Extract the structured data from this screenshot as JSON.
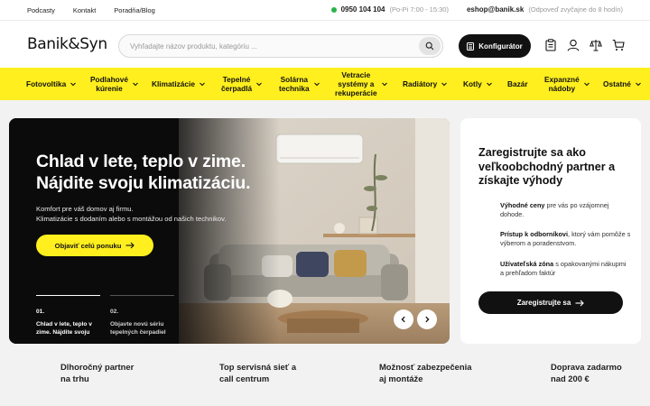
{
  "topbar": {
    "links": [
      "Podcasty",
      "Kontakt",
      "Poradňa/Blog"
    ],
    "phone": "0950 104 104",
    "hours": "(Po-Pi 7:00 - 15:30)",
    "email": "eshop@banik.sk",
    "reply_note": "(Odpoveď zvyčajne do 8 hodín)"
  },
  "header": {
    "logo": "Banik&Syn",
    "search_placeholder": "Vyhľadajte názov produktu, kategóriu ...",
    "configurator_label": "Konfigurátor",
    "icons": [
      "clipboard-icon",
      "user-icon",
      "compare-scales-icon",
      "cart-icon"
    ]
  },
  "nav": {
    "items": [
      {
        "line1": "Fotovoltika",
        "line2": "",
        "line3": "",
        "chevron": true
      },
      {
        "line1": "Podlahové",
        "line2": "kúrenie",
        "line3": "",
        "chevron": true
      },
      {
        "line1": "Klimatizácie",
        "line2": "",
        "line3": "",
        "chevron": true
      },
      {
        "line1": "Tepelné",
        "line2": "čerpadlá",
        "line3": "",
        "chevron": true
      },
      {
        "line1": "Solárna",
        "line2": "technika",
        "line3": "",
        "chevron": true
      },
      {
        "line1": "Vetracie",
        "line2": "systémy a",
        "line3": "rekuperácie",
        "chevron": true
      },
      {
        "line1": "Radiátory",
        "line2": "",
        "line3": "",
        "chevron": true
      },
      {
        "line1": "Kotly",
        "line2": "",
        "line3": "",
        "chevron": true
      },
      {
        "line1": "Bazár",
        "line2": "",
        "line3": "",
        "chevron": false
      },
      {
        "line1": "Expanzné",
        "line2": "nádoby",
        "line3": "",
        "chevron": true
      },
      {
        "line1": "Ostatné",
        "line2": "",
        "line3": "",
        "chevron": true
      }
    ]
  },
  "hero": {
    "title_line1": "Chlad v lete, teplo v zime.",
    "title_line2": "Nájdite svoju klimatizáciu.",
    "sub_line1": "Komfort pre váš domov aj firmu.",
    "sub_line2": "Klimatizácie s dodaním alebo s montážou od našich technikov.",
    "cta_label": "Objaviť celú ponuku",
    "slides": [
      {
        "num": "01.",
        "text": "Chlad v lete, teplo v zime. Nájdite svoju klimatizáciu."
      },
      {
        "num": "02.",
        "text": "Objavte novú sériu tepelných čerpadiel"
      }
    ]
  },
  "register_card": {
    "title": "Zaregistrujte sa ako veľkoobchodný partner a získajte výhody",
    "benefits": [
      {
        "bold": "Výhodné ceny",
        "text": " pre vás po vzájomnej dohode."
      },
      {
        "bold": "Prístup k odborníkovi",
        "text": ", ktorý vám pomôže s výberom a poradenstvom."
      },
      {
        "bold": "Užívateľská zóna",
        "text": " s opakovanými nákupmi a prehľadom faktúr"
      }
    ],
    "button_label": "Zaregistrujte sa"
  },
  "features": [
    {
      "line1": "Dlhoročný partner",
      "line2": "na trhu"
    },
    {
      "line1": "Top servisná sieť a",
      "line2": "call centrum"
    },
    {
      "line1": "Možnosť zabezpečenia",
      "line2": "aj montáže"
    },
    {
      "line1": "Doprava zadarmo",
      "line2": "nad 200 €"
    }
  ],
  "colors": {
    "accent_yellow": "#ffef1e",
    "dark": "#111111",
    "online_green": "#2bb24c"
  }
}
